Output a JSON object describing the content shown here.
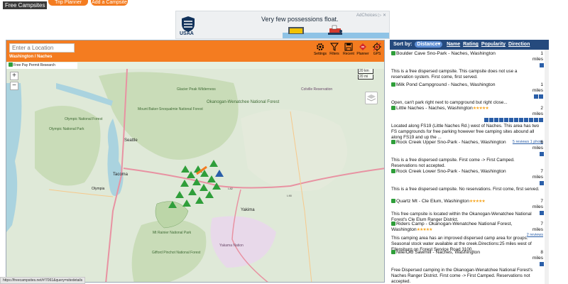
{
  "header": {
    "logo": "Free Campsites",
    "trip_planner": "Trip Planner",
    "add_campsite": "Add a Campsite"
  },
  "ad": {
    "brand": "USAA",
    "headline": "Very few possessions float.",
    "choices": "AdChoices ▷ ✕"
  },
  "map_toolbar": {
    "location_placeholder": "Enter a Location",
    "breadcrumb": "Washington / Naches",
    "tools": [
      {
        "label": "Settings",
        "icon": "gear-icon"
      },
      {
        "label": "Filters",
        "icon": "filter-icon"
      },
      {
        "label": "Recent",
        "icon": "save-icon"
      },
      {
        "label": "Planner",
        "icon": "planner-icon"
      },
      {
        "label": "GPS",
        "icon": "gps-icon"
      }
    ],
    "filters": "Free  Pay  Permit  Research"
  },
  "map": {
    "scale_top": "20 km",
    "scale_bottom": "20 mi",
    "zoom_in": "+",
    "zoom_out": "−",
    "places": [
      {
        "name": "Glacier Peak Wilderness"
      },
      {
        "name": "Okanogan-Wenatchee National Forest"
      },
      {
        "name": "Colville Reservation"
      },
      {
        "name": "Mount Baker-Snoqualmie National Forest"
      },
      {
        "name": "Olympic National Forest"
      },
      {
        "name": "Olympic National Park"
      },
      {
        "name": "Seattle"
      },
      {
        "name": "Tacoma"
      },
      {
        "name": "Olympia"
      },
      {
        "name": "Yakima"
      },
      {
        "name": "Gifford Pinchot National Forest"
      },
      {
        "name": "Yakama Nation"
      },
      {
        "name": "Mt Rainier National Park"
      }
    ],
    "status_url": "https://freecampsites.net/#!7061&query=sitedetails"
  },
  "list": {
    "sort_label": "Sort by:",
    "sort_selected": "Distance▾",
    "sort_links": [
      "Name",
      "Rating",
      "Popularity",
      "Direction"
    ],
    "campsites": [
      {
        "title": "Boulder Cave Sno-Park - Naches, Washington",
        "dist": "1",
        "unit": "miles",
        "desc": "This is a free dispersed campsite. This campsite does not use a reservation system. First come, first served."
      },
      {
        "title": "Milk Pond Campground - Naches, Washington",
        "dist": "1",
        "unit": "miles",
        "desc": "Open, can't park right next to campground but right close..."
      },
      {
        "title": "Little Naches - Naches, Washington",
        "stars": "★★★★★",
        "dist": "2",
        "unit": "miles",
        "desc": "Located along FS19 (Little Naches Rd.) west of Naches. This area has two FS campgrounds for free parking however free camping sites abound all along FS19 and up the ...",
        "reviews": "5 reviews 1 photo"
      },
      {
        "title": "Rock Creek Upper Sno-Park - Naches, Washington",
        "dist": "6",
        "unit": "miles",
        "desc": "This is a free dispersed campsite. First come -> First Camped. Reservations not accepted."
      },
      {
        "title": "Rock Creek Lower Sno-Park - Naches, Washington",
        "dist": "7",
        "unit": "miles",
        "desc": "This is a free dispersed campsite. No reservations. First come, first served."
      },
      {
        "title": "Quartz Mt - Cle Elum, Washington",
        "stars": "★★★★★",
        "dist": "7",
        "unit": "miles",
        "desc": "This free campsite is located within the Okanogan-Wenatchee National Forest's Cle Elum Ranger District."
      },
      {
        "title": "Riders Camp - Okanogan-Wenatchee National Forest, Washington",
        "stars": "★★★★★",
        "dist": "7",
        "unit": "miles",
        "desc": "This camping area has an improved dispersed camp area for groups. Seasonal stock water available at the creek.Directions:25 miles west of Ellensburg on Forest Service Road 3100.",
        "reviews": "2 reviews"
      },
      {
        "title": "Nile/Old Sawmill - Naches, Washington",
        "dist": "8",
        "unit": "miles",
        "desc": "Free Dispersed camping in the Okanogan-Wenatchee National Forest's Naches Ranger District. First come -> First Camped. Reservations not accepted."
      }
    ]
  }
}
